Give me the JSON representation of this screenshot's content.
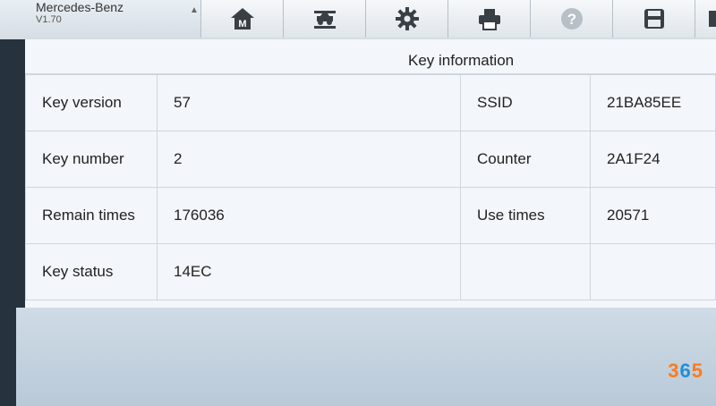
{
  "app": {
    "title": "Mercedes-Benz",
    "version": "V1.70"
  },
  "toolbar": [
    {
      "name": "home-button",
      "icon": "home-icon"
    },
    {
      "name": "vehicle-button",
      "icon": "car-lift-icon"
    },
    {
      "name": "settings-button",
      "icon": "gear-icon"
    },
    {
      "name": "print-button",
      "icon": "printer-icon"
    },
    {
      "name": "help-button",
      "icon": "help-icon"
    },
    {
      "name": "save-button",
      "icon": "save-icon"
    }
  ],
  "panel": {
    "title": "Key information"
  },
  "rows": [
    {
      "label1": "Key version",
      "value1": "57",
      "label2": "SSID",
      "value2": "21BA85EE"
    },
    {
      "label1": "Key number",
      "value1": "2",
      "label2": "Counter",
      "value2": "2A1F24"
    },
    {
      "label1": "Remain times",
      "value1": "176036",
      "label2": "Use times",
      "value2": "20571"
    },
    {
      "label1": "Key status",
      "value1": "14EC",
      "label2": "",
      "value2": ""
    }
  ],
  "watermark": {
    "text_a": "3",
    "text_b": "6",
    "text_c": "5"
  },
  "colors": {
    "accent": "#ff7a1a",
    "panel": "#f3f6fa",
    "border": "#cfd6de"
  }
}
